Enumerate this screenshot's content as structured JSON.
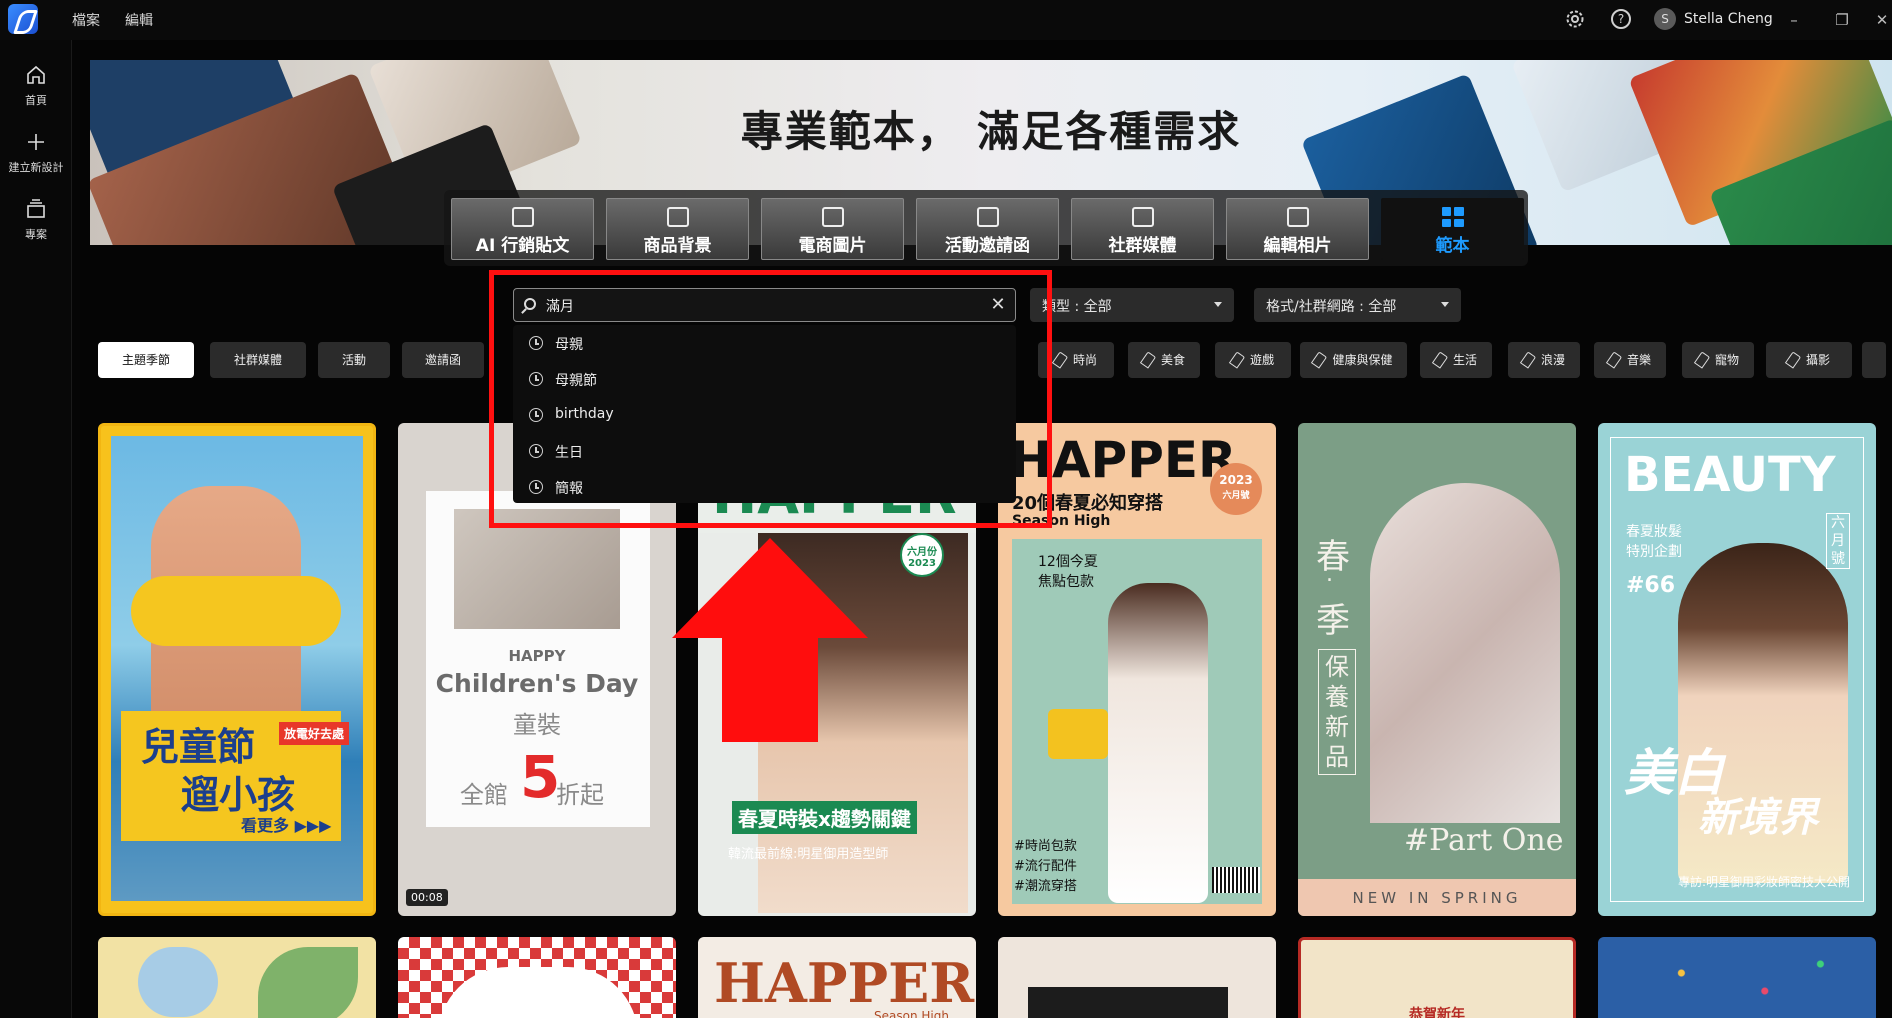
{
  "topbar": {
    "menu": [
      "檔案",
      "編輯"
    ],
    "user": {
      "initial": "S",
      "name": "Stella Cheng"
    }
  },
  "leftnav": {
    "items": [
      {
        "label": "首頁",
        "icon": "home-icon"
      },
      {
        "label": "建立新設計",
        "icon": "plus-icon"
      },
      {
        "label": "專案",
        "icon": "stack-icon"
      }
    ]
  },
  "banner": {
    "title": "專業範本，  滿足各種需求"
  },
  "tabs": [
    {
      "label": "AI 行銷貼文",
      "icon": "ai-pen-icon"
    },
    {
      "label": "商品背景",
      "icon": "image-edit-icon"
    },
    {
      "label": "電商圖片",
      "icon": "shopping-bag-icon"
    },
    {
      "label": "活動邀請函",
      "icon": "calendar-icon"
    },
    {
      "label": "社群媒體",
      "icon": "film-icon"
    },
    {
      "label": "編輯相片",
      "icon": "photo-edit-icon"
    },
    {
      "label": "範本",
      "icon": "grid-icon",
      "active": true
    }
  ],
  "search": {
    "value": "滿月"
  },
  "filters": {
    "type": "類型 : 全部",
    "format": "格式/社群網路 : 全部"
  },
  "suggestions": [
    "母親",
    "母親節",
    "birthday",
    "生日",
    "簡報"
  ],
  "chips_left": [
    "主題季節",
    "社群媒體",
    "活動",
    "邀請函"
  ],
  "chips_right": [
    "時尚",
    "美食",
    "遊戲",
    "健康與保健",
    "生活",
    "浪漫",
    "音樂",
    "寵物",
    "攝影"
  ],
  "cards": [
    {
      "title1": "兒童節",
      "title2": "遛小孩",
      "tag": "放電好去處",
      "cta": "看更多 ▶▶▶"
    },
    {
      "line1": "HAPPY",
      "line2": "Children's Day",
      "line3": "童裝",
      "prefix": "全館",
      "num": "5",
      "suffix": "折起",
      "duration": "00:08"
    },
    {
      "brand": "HAPPER",
      "stamp1": "六月份",
      "stamp2": "2023",
      "title": "春夏時裝x趨勢關鍵",
      "sub": "韓流最前線:明星御用造型師"
    },
    {
      "brand": "HAPPER",
      "year": "2023",
      "month": "六月號",
      "headline": "20個春夏必知穿搭",
      "sub": "Season High",
      "callout1": "12個今夏",
      "callout2": "焦點包款",
      "tags": [
        "#時尚包款",
        "#流行配件",
        "#潮流穿搭"
      ]
    },
    {
      "v1": "春",
      "v2": "‧",
      "v3": "季",
      "v4": "保養新品",
      "part": "#Part One",
      "footer": "NEW IN SPRING"
    },
    {
      "brand": "BEAUTY",
      "sub1": "春夏妝髮",
      "sub2": "特別企劃",
      "issue": "#66",
      "month": "六月號",
      "t1": "美白",
      "t2": "新境界",
      "footer": "專訪:明星御用彩妝師密技大公開"
    }
  ],
  "cards_row2": [
    {
      "text": ""
    },
    {
      "text": ""
    },
    {
      "brand": "HAPPER",
      "sub": "Season High"
    },
    {
      "text": ""
    },
    {
      "text": "恭賀新年"
    },
    {
      "text": ""
    }
  ]
}
